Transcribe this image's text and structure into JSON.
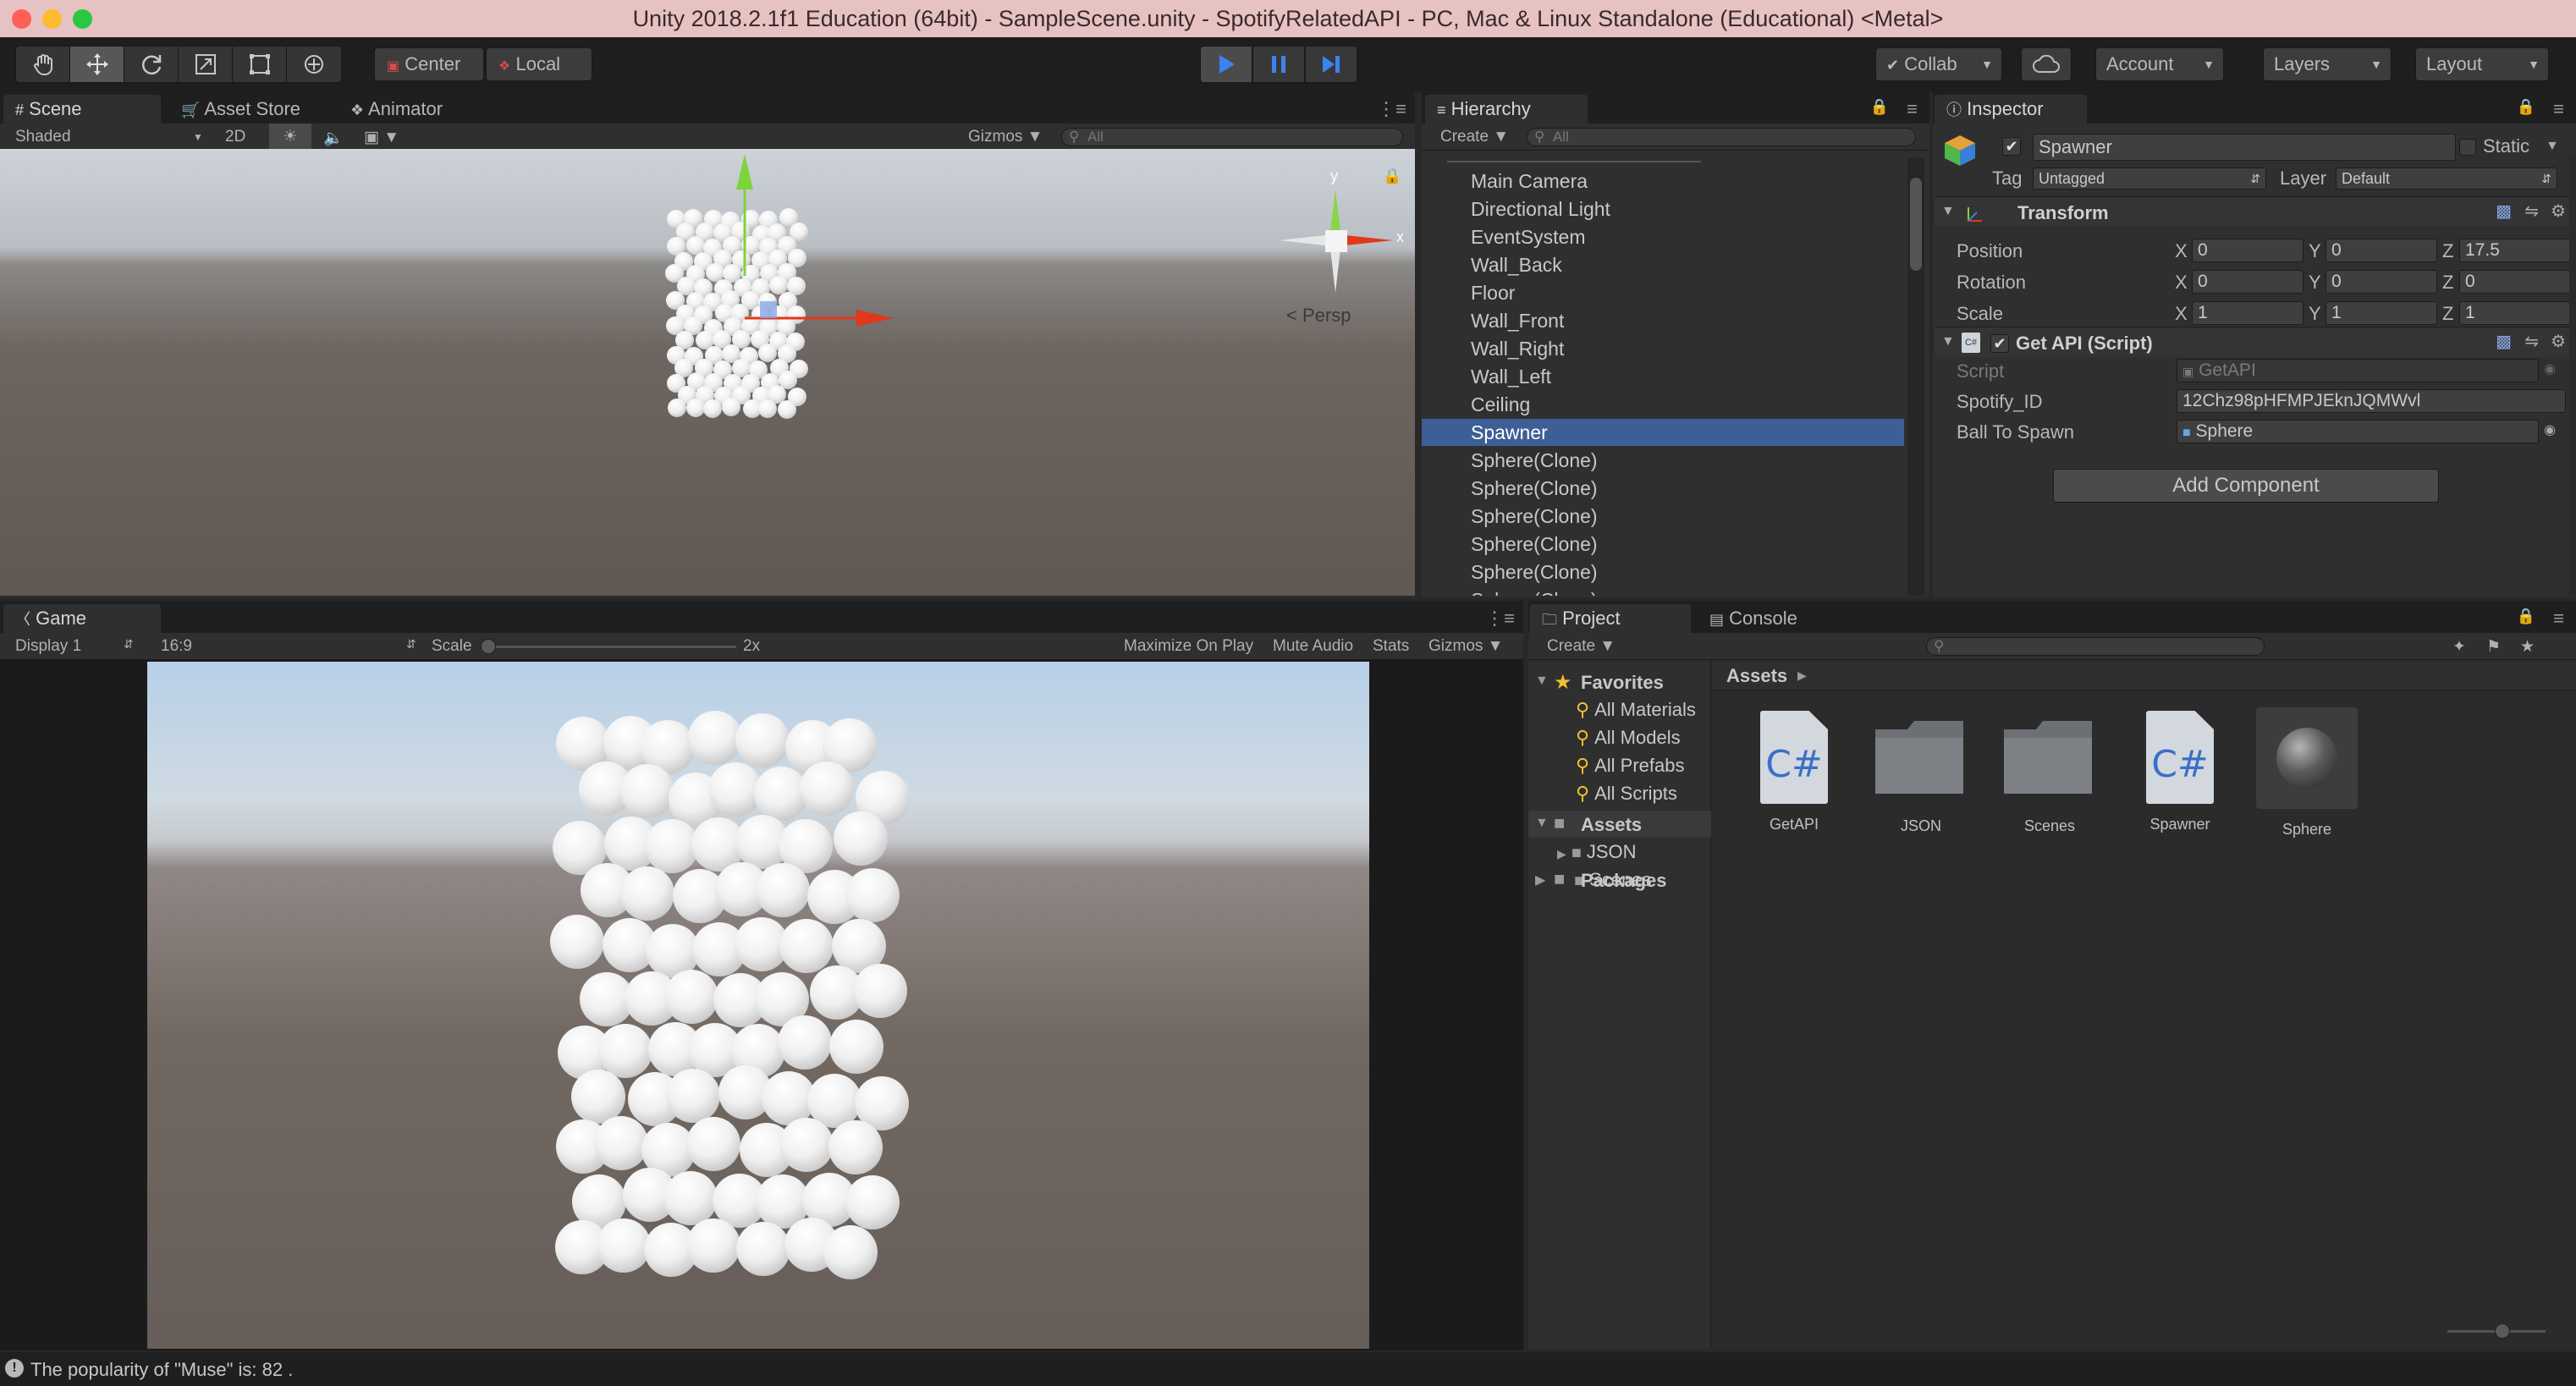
{
  "window": {
    "title": "Unity 2018.2.1f1 Education (64bit) - SampleScene.unity - SpotifyRelatedAPI - PC, Mac & Linux Standalone (Educational) <Metal>",
    "close_color": "#fe5f57",
    "minimize_color": "#febc2e",
    "maximize_color": "#28c840"
  },
  "toolbar": {
    "tools": [
      "hand-tool",
      "move-tool",
      "rotate-tool",
      "scale-tool",
      "rect-tool",
      "transform-tool"
    ],
    "pivot_label": "Center",
    "space_label": "Local",
    "collab_label": "Collab",
    "account_label": "Account",
    "layers_label": "Layers",
    "layout_label": "Layout",
    "play_color": "#3d83f0"
  },
  "scene": {
    "tabs": [
      "Scene",
      "Asset Store",
      "Animator"
    ],
    "shading": "Shaded",
    "mode_2d": "2D",
    "gizmos_label": "Gizmos",
    "search_placeholder": "All",
    "persp_label": "Persp",
    "axis_x": "x",
    "axis_y": "y"
  },
  "hierarchy": {
    "tab": "Hierarchy",
    "create_label": "Create",
    "search_placeholder": "All",
    "items": [
      "Main Camera",
      "Directional Light",
      "EventSystem",
      "Wall_Back",
      "Floor",
      "Wall_Front",
      "Wall_Right",
      "Wall_Left",
      "Ceiling",
      "Spawner",
      "Sphere(Clone)",
      "Sphere(Clone)",
      "Sphere(Clone)",
      "Sphere(Clone)",
      "Sphere(Clone)",
      "Sphere(Clone)"
    ],
    "selected_index": 9
  },
  "inspector": {
    "tab": "Inspector",
    "object_name": "Spawner",
    "static_label": "Static",
    "tag_label": "Tag",
    "tag_value": "Untagged",
    "layer_label": "Layer",
    "layer_value": "Default",
    "transform": {
      "title": "Transform",
      "rows": [
        {
          "label": "Position",
          "x": "0",
          "y": "0",
          "z": "17.5"
        },
        {
          "label": "Rotation",
          "x": "0",
          "y": "0",
          "z": "0"
        },
        {
          "label": "Scale",
          "x": "1",
          "y": "1",
          "z": "1"
        }
      ],
      "x_label": "X",
      "y_label": "Y",
      "z_label": "Z"
    },
    "script": {
      "title": "Get API (Script)",
      "script_label": "Script",
      "script_value": "GetAPI",
      "spotify_label": "Spotify_ID",
      "spotify_value": "12Chz98pHFMPJEknJQMWvl",
      "ball_label": "Ball To Spawn",
      "ball_value": "Sphere"
    },
    "add_component": "Add Component"
  },
  "game": {
    "tab": "Game",
    "display": "Display 1",
    "aspect": "16:9",
    "scale_label": "Scale",
    "scale_value": "2x",
    "maximize": "Maximize On Play",
    "mute": "Mute Audio",
    "stats": "Stats",
    "gizmos": "Gizmos"
  },
  "project": {
    "tabs": [
      "Project",
      "Console"
    ],
    "create_label": "Create",
    "favorites_label": "Favorites",
    "favorites": [
      "All Materials",
      "All Models",
      "All Prefabs",
      "All Scripts"
    ],
    "assets_label": "Assets",
    "asset_folders": [
      "JSON",
      "Scenes"
    ],
    "packages_label": "Packages",
    "breadcrumb": "Assets",
    "assets": [
      {
        "name": "GetAPI",
        "kind": "script",
        "glyph": "C#"
      },
      {
        "name": "JSON",
        "kind": "folder"
      },
      {
        "name": "Scenes",
        "kind": "folder"
      },
      {
        "name": "Spawner",
        "kind": "script",
        "glyph": "C#"
      },
      {
        "name": "Sphere",
        "kind": "material"
      }
    ]
  },
  "status": {
    "message": "The popularity of \"Muse\" is: 82 ."
  }
}
